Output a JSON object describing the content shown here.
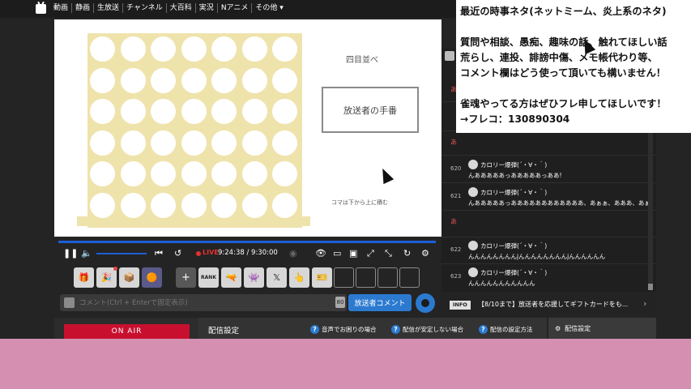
{
  "nav": {
    "links": [
      "動画",
      "静画",
      "生放送",
      "チャンネル",
      "大百科",
      "実況",
      "Nアニメ",
      "その他 ▾"
    ]
  },
  "stage": {
    "title": "四目並べ",
    "turn_label": "放送者の手番",
    "note": "コマは下から上に積む"
  },
  "player": {
    "live_label": "LIVE",
    "time": "9:24:38 / 9:30:00"
  },
  "tools": {
    "rank_label": "RANK"
  },
  "comment_input": {
    "placeholder": "コメント(Ctrl + Enterで固定表示)",
    "count": "80",
    "broadcaster_button": "放送者コメント"
  },
  "footer": {
    "on_air": "ON AIR",
    "settings_title": "配信設定",
    "help_audio": "音声でお困りの場合",
    "help_unstable": "配信が安定しない場合",
    "help_setup": "配信の設定方法",
    "settings_button": "配信設定"
  },
  "comments": [
    {
      "num": "620",
      "user": "カロリー爆弾(´・∀・｀)",
      "text": "んあああああっあああああっああ!"
    },
    {
      "num": "621",
      "user": "カロリー爆弾(´・∀・｀)",
      "text": "んあああああっああああああああああああ、あぁぁ、あああ、あぁ"
    },
    {
      "num": "622",
      "user": "カロリー爆弾(´・∀・｀)",
      "text": "んんんんんんんんjんんんんんんんんjんんんんんん"
    },
    {
      "num": "623",
      "user": "カロリー爆弾(´・∀・｀)",
      "text": "んんんんんんんんんんん"
    }
  ],
  "anchors": [
    "あ",
    "あ",
    "あ"
  ],
  "info": {
    "badge": "INFO",
    "text": "【8/10まで】放送者を応援してギフトカードをも..."
  },
  "note": {
    "line1": "最近の時事ネタ(ネットミーム、炎上系のネタ)",
    "line2": "質問や相談、愚痴、趣味の話、触れてほしい話",
    "line3": "荒らし、連投、誹謗中傷、メモ帳代わり等、",
    "line4": "コメント欄はどう使って頂いても構いません！",
    "line5": "雀魂やってる方はぜひフレ申してほしいです！",
    "line6": "→フレコ：130890304"
  },
  "colors": {
    "board": "#efe3ac",
    "accent_blue": "#2b7ad0",
    "live_red": "#e53030",
    "on_air_red": "#c8102e",
    "background_pink": "#d58fb1"
  }
}
